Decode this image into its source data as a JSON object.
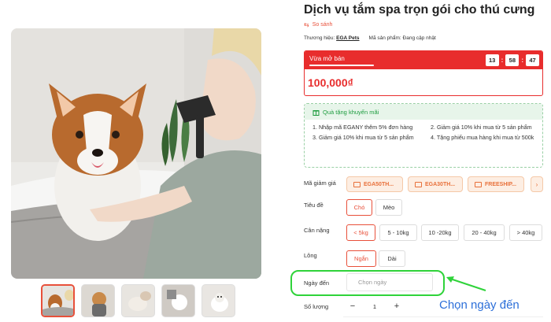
{
  "product": {
    "title": "Dịch vụ tắm spa trọn gói cho thú cưng",
    "compare_label": "So sánh",
    "brand_label": "Thương hiệu:",
    "brand_value": "EGA Pets",
    "sku_label": "Mã sản phẩm:",
    "sku_value": "Đang cập nhật"
  },
  "gallery": {
    "thumbnail_count": 5,
    "active_index": 0
  },
  "flash_sale": {
    "label": "Vừa mở bán",
    "progress_fraction": 1.0,
    "timer": {
      "hours": "13",
      "minutes": "58",
      "seconds": "47"
    },
    "price": "100,000₫",
    "accent_color": "#e82d2d"
  },
  "promo": {
    "title": "Quà tặng khuyến mãi",
    "items": [
      "1. Nhập mã EGANY thêm 5% đơn hàng",
      "2. Giảm giá 10% khi mua từ 5 sản phẩm",
      "3. Giảm giá 10% khi mua từ 5 sản phẩm",
      "4. Tặng phiếu mua hàng khi mua từ 500k"
    ],
    "accent_color": "#1c9c3e"
  },
  "coupons": {
    "label": "Mã giảm giá",
    "codes": [
      "EGA50TH...",
      "EGA30TH...",
      "FREESHIP..."
    ],
    "next_icon": "chevron-right-icon"
  },
  "options": {
    "title_label": "Tiêu đề",
    "title_values": [
      "Chó",
      "Mèo"
    ],
    "title_selected": "Chó",
    "weight_label": "Cân nặng",
    "weight_values": [
      "< 5kg",
      "5 - 10kg",
      "10 -20kg",
      "20 - 40kg",
      "> 40kg"
    ],
    "weight_selected": "< 5kg",
    "fur_label": "Lông",
    "fur_values": [
      "Ngắn",
      "Dài"
    ],
    "fur_selected": "Ngắn"
  },
  "date": {
    "label": "Ngày đến",
    "placeholder": "Chọn ngày"
  },
  "quantity": {
    "label": "Số lượng",
    "minus": "−",
    "value": "1",
    "plus": "+"
  },
  "annotation": {
    "text": "Chọn ngày đến",
    "color": "#2fd33a"
  }
}
